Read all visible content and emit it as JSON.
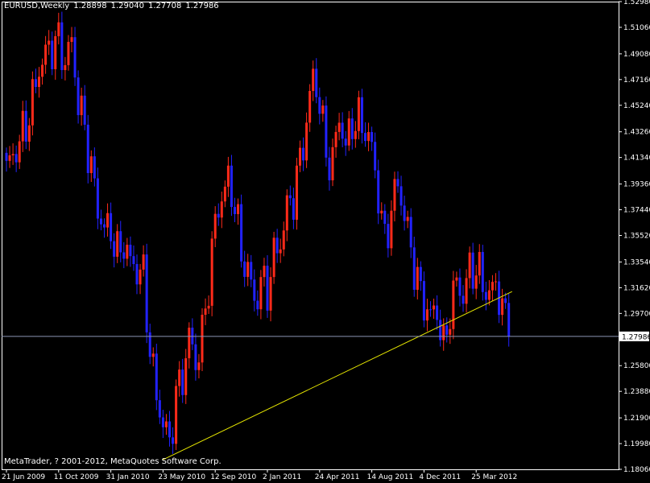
{
  "header": {
    "symbol": "EURUSD,Weekly",
    "open": "1.28898",
    "high": "1.29040",
    "low": "1.27708",
    "close": "1.27986"
  },
  "copyright": "MetaTrader, ? 2001-2012, MetaQuotes Software Corp.",
  "colors": {
    "background": "#000000",
    "frame": "#ffffff",
    "bull_candle": "#ff2a1a",
    "bear_candle": "#2222ff",
    "trendline": "#e6e600",
    "price_line": "#8c96b4",
    "price_badge_bg": "#ffffff",
    "price_badge_text": "#000000"
  },
  "chart_data": {
    "type": "candlestick",
    "symbol": "EURUSD",
    "timeframe": "Weekly",
    "ylim": [
      1.1806,
      1.5298
    ],
    "y_tick_labels": [
      "1.52980",
      "1.51060",
      "1.49080",
      "1.47160",
      "1.45240",
      "1.43260",
      "1.41340",
      "1.39360",
      "1.37440",
      "1.35520",
      "1.33540",
      "1.31620",
      "1.29700",
      "1.25800",
      "1.23880",
      "1.21900",
      "1.19980",
      "1.18060"
    ],
    "current_price_label": "1.27986",
    "current_price": 1.27986,
    "x_tick_labels": [
      "21 Jun 2009",
      "11 Oct 2009",
      "31 Jan 2010",
      "23 May 2010",
      "12 Sep 2010",
      "2 Jan 2011",
      "24 Apr 2011",
      "14 Aug 2011",
      "4 Dec 2011",
      "25 Mar 2012"
    ],
    "x_tick_bars": [
      0,
      16,
      32,
      48,
      64,
      80,
      96,
      112,
      128,
      144
    ],
    "bar_count": 155,
    "price_anchors": [
      [
        0,
        1.405
      ],
      [
        4,
        1.425
      ],
      [
        7,
        1.445
      ],
      [
        10,
        1.48
      ],
      [
        13,
        1.495
      ],
      [
        16,
        1.5
      ],
      [
        18,
        1.485
      ],
      [
        20,
        1.5
      ],
      [
        22,
        1.455
      ],
      [
        24,
        1.435
      ],
      [
        26,
        1.405
      ],
      [
        28,
        1.375
      ],
      [
        30,
        1.36
      ],
      [
        32,
        1.36
      ],
      [
        34,
        1.34
      ],
      [
        36,
        1.35
      ],
      [
        38,
        1.335
      ],
      [
        40,
        1.33
      ],
      [
        42,
        1.325
      ],
      [
        44,
        1.27
      ],
      [
        46,
        1.235
      ],
      [
        48,
        1.215
      ],
      [
        50,
        1.2
      ],
      [
        52,
        1.235
      ],
      [
        54,
        1.25
      ],
      [
        56,
        1.28
      ],
      [
        58,
        1.26
      ],
      [
        60,
        1.28
      ],
      [
        62,
        1.32
      ],
      [
        64,
        1.365
      ],
      [
        66,
        1.385
      ],
      [
        68,
        1.395
      ],
      [
        70,
        1.38
      ],
      [
        72,
        1.34
      ],
      [
        74,
        1.33
      ],
      [
        76,
        1.305
      ],
      [
        78,
        1.32
      ],
      [
        80,
        1.315
      ],
      [
        82,
        1.34
      ],
      [
        84,
        1.35
      ],
      [
        86,
        1.375
      ],
      [
        88,
        1.385
      ],
      [
        90,
        1.41
      ],
      [
        92,
        1.44
      ],
      [
        94,
        1.475
      ],
      [
        96,
        1.455
      ],
      [
        98,
        1.415
      ],
      [
        100,
        1.41
      ],
      [
        102,
        1.445
      ],
      [
        104,
        1.42
      ],
      [
        106,
        1.44
      ],
      [
        108,
        1.44
      ],
      [
        110,
        1.435
      ],
      [
        112,
        1.42
      ],
      [
        114,
        1.385
      ],
      [
        116,
        1.35
      ],
      [
        118,
        1.375
      ],
      [
        120,
        1.395
      ],
      [
        122,
        1.37
      ],
      [
        124,
        1.345
      ],
      [
        126,
        1.32
      ],
      [
        128,
        1.305
      ],
      [
        130,
        1.295
      ],
      [
        132,
        1.3
      ],
      [
        134,
        1.27
      ],
      [
        136,
        1.3
      ],
      [
        138,
        1.32
      ],
      [
        140,
        1.31
      ],
      [
        142,
        1.33
      ],
      [
        144,
        1.33
      ],
      [
        146,
        1.32
      ],
      [
        148,
        1.31
      ],
      [
        150,
        1.32
      ],
      [
        152,
        1.3
      ],
      [
        154,
        1.285
      ]
    ],
    "trendline": {
      "start": [
        "22 May 2010",
        1.1876
      ],
      "end": [
        "10 Jun 2012",
        1.3133
      ]
    },
    "grid": false
  }
}
